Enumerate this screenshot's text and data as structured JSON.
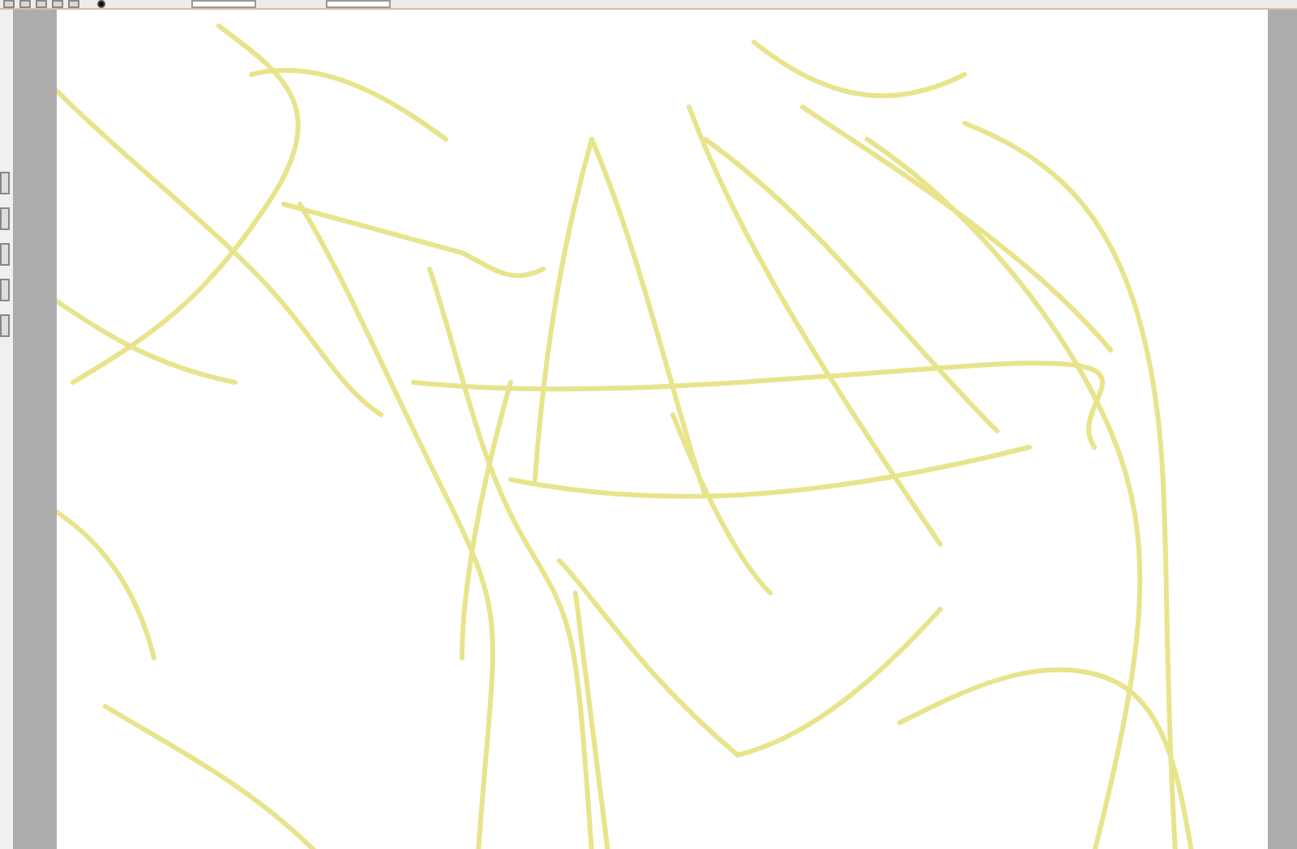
{
  "toolbar": {
    "selection_display": {
      "checked": true
    }
  }
}
